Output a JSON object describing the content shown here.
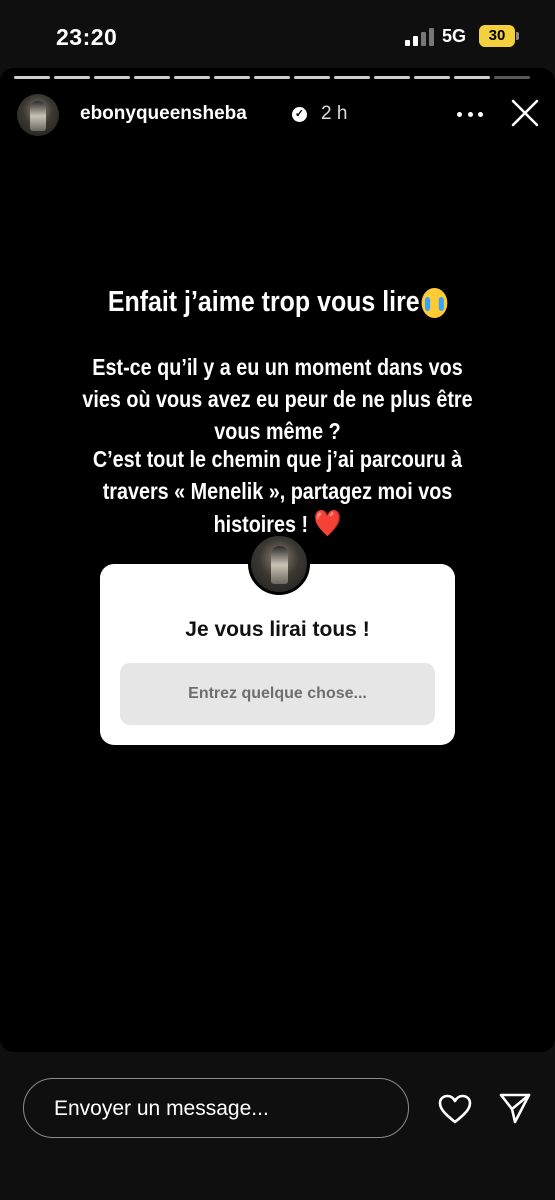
{
  "status_bar": {
    "time": "23:20",
    "network": "5G",
    "battery": "30",
    "battery_color": "#f2d03e"
  },
  "story": {
    "progress_segments": 13,
    "header": {
      "username": "ebonyqueensheba",
      "verified_icon": "verified-badge-icon",
      "time_ago": "2 h"
    },
    "text": {
      "line1": "Enfait j’aime trop vous lire",
      "line1_emoji": "loudly-crying-face",
      "paragraph2": "Est-ce qu’il y a eu un moment dans vos vies où vous avez eu peur de ne plus être vous même ?",
      "paragraph3": "C’est tout le chemin que j’ai parcouru à travers « Menelik », partagez moi vos histoires !",
      "paragraph3_emoji": "❤️"
    },
    "question_sticker": {
      "title": "Je vous lirai tous !",
      "placeholder": "Entrez quelque chose..."
    }
  },
  "footer": {
    "message_placeholder": "Envoyer un message...",
    "like_icon": "heart-icon",
    "send_icon": "send-icon"
  }
}
